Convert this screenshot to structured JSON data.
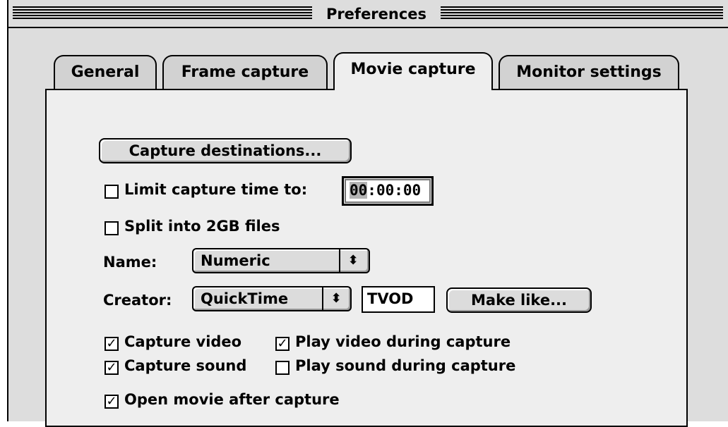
{
  "window": {
    "title": "Preferences"
  },
  "tabs": [
    {
      "label": "General",
      "active": false
    },
    {
      "label": "Frame capture",
      "active": false
    },
    {
      "label": "Movie capture",
      "active": true
    },
    {
      "label": "Monitor settings",
      "active": false
    }
  ],
  "movie_capture": {
    "capture_destinations_button": "Capture destinations...",
    "limit_capture_time": {
      "label": "Limit capture time to:",
      "checked": false,
      "value_selected": "00",
      "value_rest": ":00:00"
    },
    "split_files": {
      "label": "Split into 2GB files",
      "checked": false
    },
    "name": {
      "label": "Name:",
      "value": "Numeric",
      "arrow": "⬍"
    },
    "creator": {
      "label": "Creator:",
      "value": "QuickTime",
      "arrow": "⬍",
      "code": "TVOD",
      "make_like_button": "Make like..."
    },
    "capture_video": {
      "label": "Capture video",
      "checked": true
    },
    "play_video": {
      "label": "Play video during capture",
      "checked": true
    },
    "capture_sound": {
      "label": "Capture sound",
      "checked": true
    },
    "play_sound": {
      "label": "Play sound during capture",
      "checked": false
    },
    "open_movie": {
      "label": "Open movie after capture",
      "checked": true
    },
    "check_mark": "✓"
  }
}
